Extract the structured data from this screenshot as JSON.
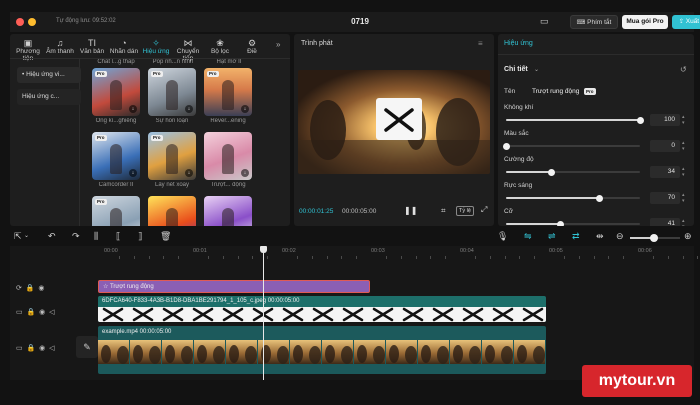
{
  "titlebar": {
    "autosave": "Tự động lưu: 09:52:02",
    "project_title": "0719",
    "shortcuts_label": "Phím tắt",
    "buy_pro_label": "Mua gói Pro",
    "export_label": "Xuất"
  },
  "toolbar": {
    "items": [
      {
        "label": "Phương tiện",
        "icon": "media-icon"
      },
      {
        "label": "Âm thanh",
        "icon": "audio-icon"
      },
      {
        "label": "Văn bản",
        "icon": "text-icon"
      },
      {
        "label": "Nhãn dán",
        "icon": "sticker-icon"
      },
      {
        "label": "Hiệu ứng",
        "icon": "effects-icon"
      },
      {
        "label": "Chuyển tiếp",
        "icon": "transition-icon"
      },
      {
        "label": "Bộ lọc",
        "icon": "filter-icon"
      },
      {
        "label": "Điề",
        "icon": "adjust-icon"
      }
    ],
    "more": "»"
  },
  "effects_sidebar": {
    "items": [
      "• Hiệu ứng vi...",
      "Hiệu ứng c..."
    ]
  },
  "effects_grid": {
    "top_captions": [
      "Chất l...g thấp",
      "Pop nh...n hình",
      "Hạt mờ II"
    ],
    "items": [
      {
        "caption": "Ống kí...ghiêng",
        "pro": "Pro"
      },
      {
        "caption": "Sự hỗn loạn",
        "pro": "Pro"
      },
      {
        "caption": "Rever...ening",
        "pro": "Pro"
      },
      {
        "caption": "Camcorder II",
        "pro": "Pro"
      },
      {
        "caption": "Lấy nét xoay",
        "pro": "Pro"
      },
      {
        "caption": "Trượt... động",
        "pro": ""
      },
      {
        "caption": "",
        "pro": "Pro"
      },
      {
        "caption": "",
        "pro": ""
      },
      {
        "caption": "",
        "pro": ""
      }
    ]
  },
  "player": {
    "title": "Trình phát",
    "current_time": "00:00:01:25",
    "total_time": "00:00:05:00",
    "ratio_label": "Tỷ lệ"
  },
  "inspector": {
    "tab": "Hiệu ứng",
    "section": "Chi tiết",
    "name_label": "Tên",
    "name_value": "Trượt rung động",
    "pro_badge": "Pro",
    "params": [
      {
        "label": "Không khí",
        "value": "100",
        "fraction": 1.0
      },
      {
        "label": "Màu sắc",
        "value": "0",
        "fraction": 0.0
      },
      {
        "label": "Cường độ",
        "value": "34",
        "fraction": 0.34
      },
      {
        "label": "Rực sáng",
        "value": "70",
        "fraction": 0.7
      },
      {
        "label": "Cỡ",
        "value": "41",
        "fraction": 0.41
      }
    ]
  },
  "timeline": {
    "ruler": [
      "00:00",
      "00:01",
      "00:02",
      "00:03",
      "00:04",
      "00:05",
      "00:06"
    ],
    "effect_clip": "Trượt rung động",
    "image_clip": "6DFCA640-F833-4A3B-B1D8-DBA1BE291794_1_105_c.jpeg  00:00:05:00",
    "video_clip": "example.mp4  00:00:05:00",
    "playhead_fraction": 0.37
  },
  "watermark": "mytour.vn",
  "colors": {
    "accent": "#31c2d3",
    "effect_clip": "#8b5fb4",
    "image_clip": "#1d6f6a",
    "video_clip": "#1c5a5c",
    "watermark": "#d7262c"
  }
}
